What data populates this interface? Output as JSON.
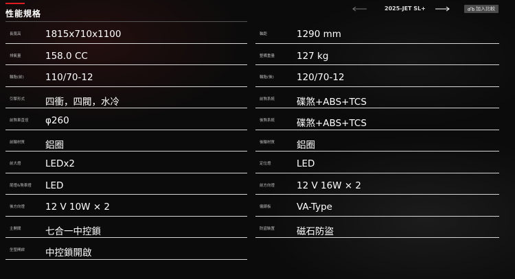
{
  "section": {
    "title": "性能規格"
  },
  "header": {
    "model": "2025-JET SL+",
    "compare_label": "加入比較",
    "prev_icon": "arrow-left-icon",
    "next_icon": "arrow-right-icon"
  },
  "specs_left": [
    {
      "label": "長寬高",
      "value": "1815x710x1100"
    },
    {
      "label": "排氣量",
      "value": "158.0 CC"
    },
    {
      "label": "輪胎(前)",
      "value": "110/70-12"
    },
    {
      "label": "引擎形式",
      "value": "四衝，四閥，水冷"
    },
    {
      "label": "前煞車直徑",
      "value": "φ260"
    },
    {
      "label": "前輪材質",
      "value": "鋁圈"
    },
    {
      "label": "前大燈",
      "value": "LEDx2"
    },
    {
      "label": "尾燈&煞車燈",
      "value": "LED"
    },
    {
      "label": "後方向燈",
      "value": "12 V 10W × 2"
    },
    {
      "label": "主開關",
      "value": "七合一中控鎖"
    },
    {
      "label": "坐墊開啟",
      "value": "中控鎖開啟"
    }
  ],
  "specs_right": [
    {
      "label": "軸距",
      "value": "1290 mm"
    },
    {
      "label": "整備重量",
      "value": "127 kg"
    },
    {
      "label": "輪胎(後)",
      "value": "120/70-12"
    },
    {
      "label": "前煞系統",
      "value": "碟煞+ABS+TCS"
    },
    {
      "label": "後煞系統",
      "value": "碟煞+ABS+TCS"
    },
    {
      "label": "後輪材質",
      "value": "鋁圈"
    },
    {
      "label": "定位燈",
      "value": "LED"
    },
    {
      "label": "前方向燈",
      "value": "12 V 16W × 2"
    },
    {
      "label": "儀錶板",
      "value": "VA-Type"
    },
    {
      "label": "防盜裝置",
      "value": "磁石防盜"
    }
  ]
}
